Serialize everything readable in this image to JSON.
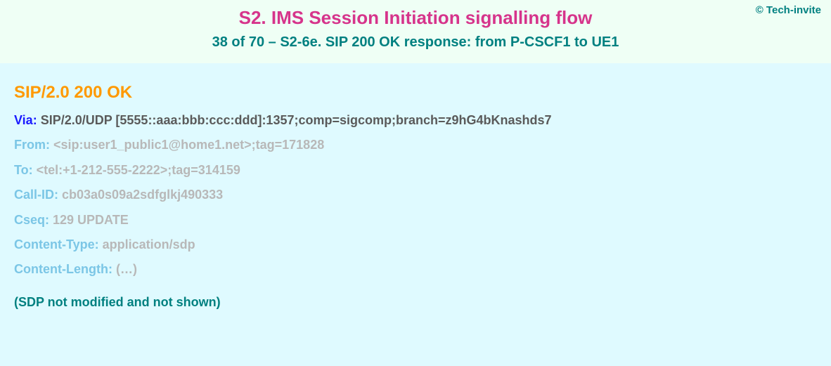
{
  "copyright": "© Tech-invite",
  "header": {
    "title": "S2. IMS Session Initiation signalling flow",
    "subtitle": "38 of 70 – S2-6e. SIP 200 OK response: from P-CSCF1 to UE1"
  },
  "request_line": "SIP/2.0 200 OK",
  "headers": [
    {
      "style": "primary",
      "name": "Via:",
      "value": " SIP/2.0/UDP [5555::aaa:bbb:ccc:ddd]:1357;comp=sigcomp;branch=z9hG4bKnashds7"
    },
    {
      "style": "dim",
      "name": "From:",
      "value": " <sip:user1_public1@home1.net>;tag=171828"
    },
    {
      "style": "dim",
      "name": "To:",
      "value": " <tel:+1-212-555-2222>;tag=314159"
    },
    {
      "style": "dim",
      "name": "Call-ID:",
      "value": " cb03a0s09a2sdfglkj490333"
    },
    {
      "style": "dim",
      "name": "Cseq:",
      "value": " 129 UPDATE"
    },
    {
      "style": "dim",
      "name": "Content-Type:",
      "value": " application/sdp"
    },
    {
      "style": "dim",
      "name": "Content-Length:",
      "value": " (…)"
    }
  ],
  "note": "(SDP not modified and not shown)"
}
